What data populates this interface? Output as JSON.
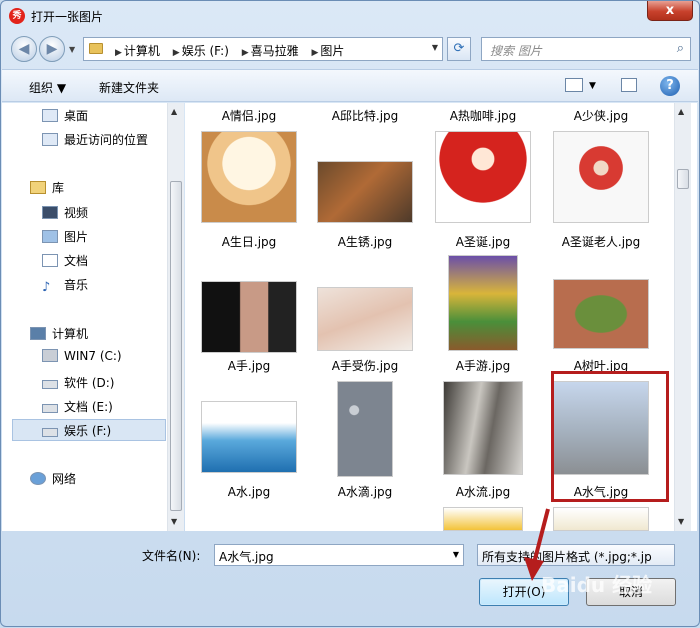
{
  "title": "打开一张图片",
  "app_icon": "秀",
  "close_label": "x",
  "address": {
    "crumbs": [
      "计算机",
      "娱乐 (F:)",
      "喜马拉雅",
      "图片"
    ]
  },
  "search": {
    "placeholder": "搜索 图片"
  },
  "toolbar": {
    "organize": "组织 ▼",
    "new_folder": "新建文件夹"
  },
  "sidebar": {
    "items": [
      {
        "label": "桌面",
        "icon": "desktop-icon"
      },
      {
        "label": "最近访问的位置",
        "icon": "recent-places-icon"
      },
      {
        "label": "库",
        "icon": "library-icon"
      },
      {
        "label": "视频",
        "icon": "video-icon"
      },
      {
        "label": "图片",
        "icon": "pictures-icon"
      },
      {
        "label": "文档",
        "icon": "documents-icon"
      },
      {
        "label": "音乐",
        "icon": "music-icon"
      },
      {
        "label": "计算机",
        "icon": "computer-icon"
      },
      {
        "label": "WIN7 (C:)",
        "icon": "drive-icon"
      },
      {
        "label": "软件 (D:)",
        "icon": "drive-icon"
      },
      {
        "label": "文档 (E:)",
        "icon": "drive-icon"
      },
      {
        "label": "娱乐 (F:)",
        "icon": "drive-icon",
        "selected": true
      },
      {
        "label": "网络",
        "icon": "network-icon"
      }
    ]
  },
  "files": {
    "top_names": [
      "A情侣.jpg",
      "A邱比特.jpg",
      "A热咖啡.jpg",
      "A少侠.jpg"
    ],
    "row1": [
      "A生日.jpg",
      "A生锈.jpg",
      "A圣诞.jpg",
      "A圣诞老人.jpg"
    ],
    "row2": [
      "A手.jpg",
      "A手受伤.jpg",
      "A手游.jpg",
      "A树叶.jpg"
    ],
    "row3": [
      "A水.jpg",
      "A水滴.jpg",
      "A水流.jpg",
      "A水气.jpg"
    ],
    "selected": "A水气.jpg"
  },
  "bottom": {
    "filename_label": "文件名(N):",
    "filename_value": "A水气.jpg",
    "filter_value": "所有支持的图片格式 (*.jpg;*.jp",
    "open_label": "打开(O)",
    "cancel_label": "取消"
  },
  "watermark": "Baidu 经验",
  "colors": {
    "highlight_box": "#b51d1d",
    "selected_bg": "#d9e6f4"
  }
}
